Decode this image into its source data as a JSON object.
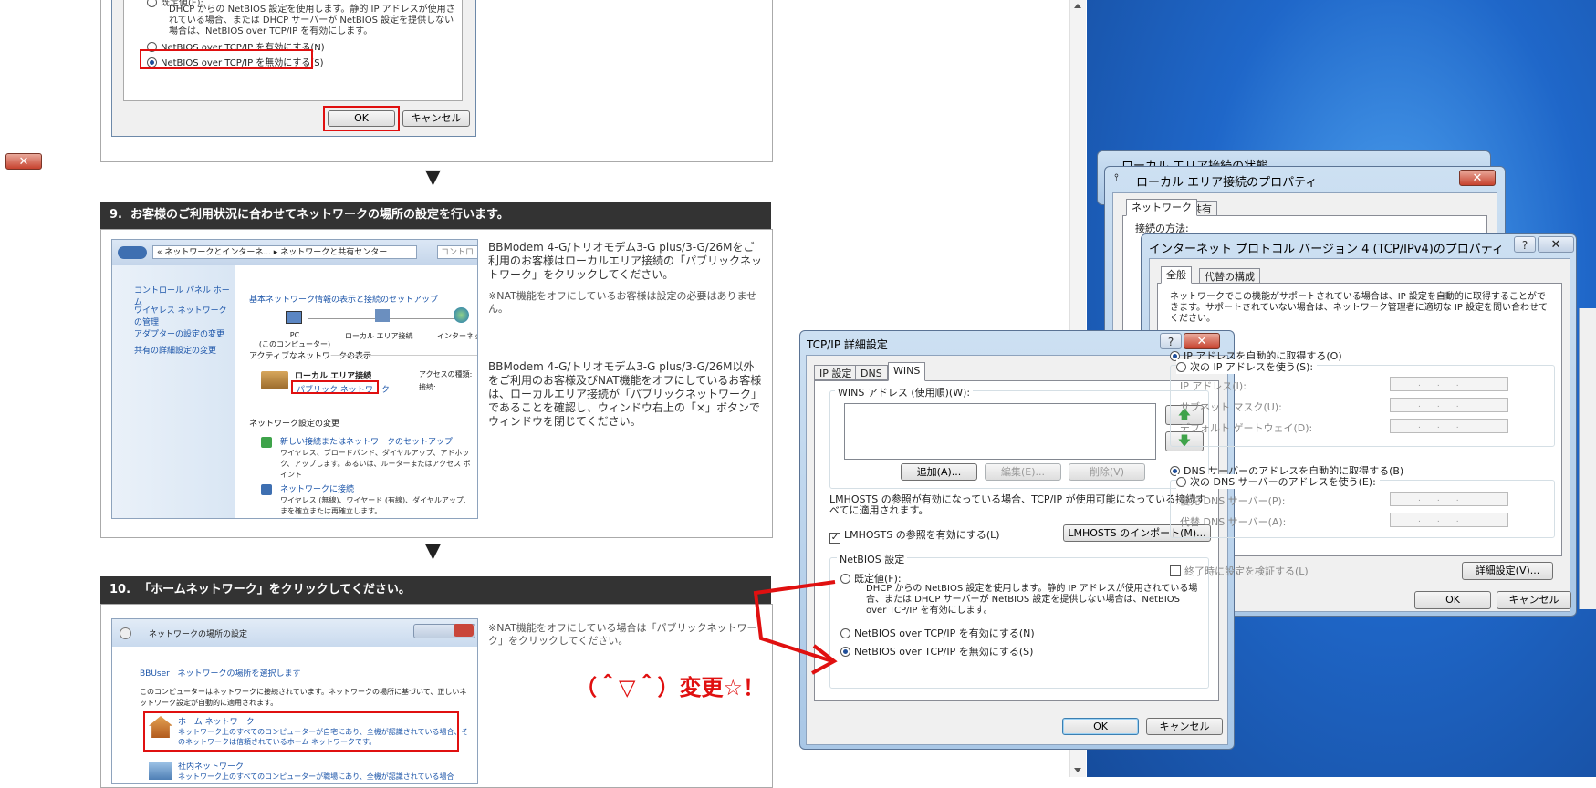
{
  "top_dialog": {
    "partial_text": "既定値(F):",
    "desc": "DHCP からの NetBIOS 設定を使用します。静的 IP アドレスが使用されている場合、または DHCP サーバーが NetBIOS 設定を提供しない場合は、NetBIOS over TCP/IP を有効にします。",
    "radio_enable": "NetBIOS over TCP/IP を有効にする(N)",
    "radio_disable": "NetBIOS over TCP/IP を無効にする(S)",
    "ok": "OK",
    "cancel": "キャンセル"
  },
  "arrow_glyph": "▼",
  "step9": {
    "title": "9.  お客様のご利用状況に合わせてネットワークの場所の設定を行います。",
    "text1": "BBModem 4-G/トリオモデム3-G plus/3-G/26Mをご利用のお客様はローカルエリア接続の「パブリックネットワーク」をクリックしてください。",
    "note1": "※NAT機能をオフにしているお客様は設定の必要はありません。",
    "text2": "BBModem 4-G/トリオモデム3-G plus/3-G/26M以外をご利用のお客様及びNAT機能をオフにしているお客様は、ローカルエリア接続が「パブリックネットワーク」であることを確認し、ウィンドウ右上の「×」ボタンでウィンドウを閉じてください。",
    "shot": {
      "breadcrumb": "« ネットワークとインターネ... ▸ ネットワークと共有センター",
      "search": "コントロ",
      "side": [
        "コントロール パネル ホーム",
        "ワイヤレス ネットワークの管理",
        "アダプターの設定の変更",
        "共有の詳細設定の変更"
      ],
      "heading": "基本ネットワーク情報の表示と接続のセットアップ",
      "pc": "PC",
      "pc_sub": "(このコンピューター)",
      "lan": "ローカル エリア接続",
      "inet": "インターネッ",
      "active": "アクティブなネットワークの表示",
      "net_name": "ローカル エリア接続",
      "net_type": "パブリック ネットワーク",
      "access_type": "アクセスの種類:",
      "connection": "接続:",
      "change": "ネットワーク設定の変更",
      "task1": "新しい接続またはネットワークのセットアップ",
      "task1_desc": "ワイヤレス、ブロードバンド、ダイヤルアップ、アドホック、アップします。あるいは、ルーターまたはアクセス ポイント",
      "task2": "ネットワークに接続",
      "task2_desc": "ワイヤレス (無線)、ワイヤード (有線)、ダイヤルアップ、まを確立または再確立します。"
    }
  },
  "step10": {
    "title": "10.  「ホームネットワーク」をクリックしてください。",
    "note": "※NAT機能をオフにしている場合は「パブリックネットワーク」をクリックしてください。",
    "shot": {
      "title": "ネットワークの場所の設定",
      "subtitle": "BBUser   ネットワークの場所を選択します",
      "desc": "このコンピューターはネットワークに接続されています。ネットワークの場所に基づいて、正しいネットワーク設定が自動的に適用されます。",
      "home": "ホーム ネットワーク",
      "home_desc": "ネットワーク上のすべてのコンピューターが自宅にあり、全機が認識されている場合、そのネットワークは信頼されているホーム ネットワークです。",
      "work": "社内ネットワーク",
      "work_desc": "ネットワーク上のすべてのコンピューターが職場にあり、全機が認識されている場合"
    }
  },
  "annotation": "（＾▽＾）変更☆！",
  "tcpip_dialog": {
    "title": "TCP/IP 詳細設定",
    "tabs": [
      "IP 設定",
      "DNS",
      "WINS"
    ],
    "wins_label": "WINS アドレス (使用順)(W):",
    "add": "追加(A)...",
    "edit": "編集(E)...",
    "remove": "削除(V)",
    "lmhosts_text": "LMHOSTS の参照が有効になっている場合、TCP/IP が使用可能になっている接続すべてに適用されます。",
    "lmhosts_check": "LMHOSTS の参照を有効にする(L)",
    "lmhosts_import": "LMHOSTS のインポート(M)...",
    "netbios_group": "NetBIOS 設定",
    "radio_default": "既定値(F):",
    "default_desc": "DHCP からの NetBIOS 設定を使用します。静的 IP アドレスが使用されている場合、または DHCP サーバーが NetBIOS 設定を提供しない場合は、NetBIOS over TCP/IP を有効にします。",
    "radio_enable": "NetBIOS over TCP/IP を有効にする(N)",
    "radio_disable": "NetBIOS over TCP/IP を無効にする(S)",
    "ok": "OK",
    "cancel": "キャンセル"
  },
  "lan_status": {
    "title": "ローカル エリア接続の状態"
  },
  "lan_props": {
    "title": "ローカル エリア接続のプロパティ",
    "tabs": [
      "ネットワーク",
      "共有"
    ],
    "connect_using": "接続の方法:"
  },
  "ipv4_dialog": {
    "title": "インターネット プロトコル バージョン 4 (TCP/IPv4)のプロパティ",
    "tabs": [
      "全般",
      "代替の構成"
    ],
    "desc": "ネットワークでこの機能がサポートされている場合は、IP 設定を自動的に取得することができます。サポートされていない場合は、ネットワーク管理者に適切な IP 設定を問い合わせてください。",
    "auto_ip": "IP アドレスを自動的に取得する(O)",
    "manual_ip": "次の IP アドレスを使う(S):",
    "ip_label": "IP アドレス(I):",
    "mask_label": "サブネット マスク(U):",
    "gw_label": "デフォルト ゲートウェイ(D):",
    "auto_dns": "DNS サーバーのアドレスを自動的に取得する(B)",
    "manual_dns": "次の DNS サーバーのアドレスを使う(E):",
    "pref_dns": "優先 DNS サーバー(P):",
    "alt_dns": "代替 DNS サーバー(A):",
    "validate": "終了時に設定を検証する(L)",
    "advanced": "詳細設定(V)...",
    "ok": "OK",
    "cancel": "キャンセル"
  },
  "colors": {
    "desktop": "#1f67c9",
    "highlight": "#e01010",
    "step_bar": "#333333"
  }
}
